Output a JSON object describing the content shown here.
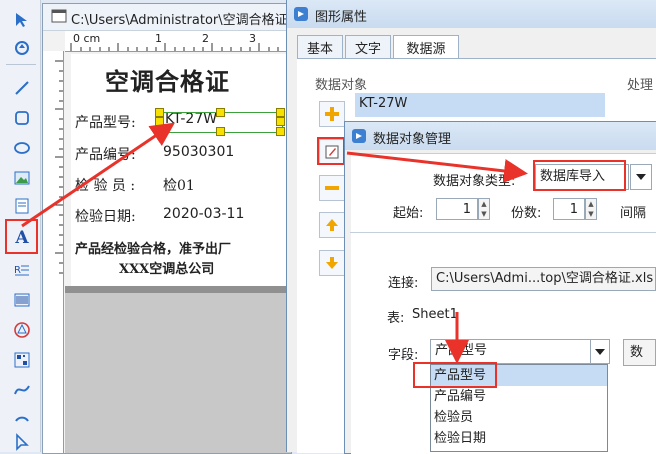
{
  "canvas_window": {
    "title": "C:\\Users\\Administrator\\空调合格证",
    "ruler_labels": [
      "0 cm",
      "1",
      "2",
      "3",
      "4"
    ],
    "label": {
      "heading": "空调合格证",
      "rows": [
        {
          "name": "产品型号:",
          "value": "KT-27W"
        },
        {
          "name": "产品编号:",
          "value": "95030301"
        },
        {
          "name": "检 验 员 :",
          "value": "检01"
        },
        {
          "name": "检验日期:",
          "value": "2020-03-11"
        }
      ],
      "footer_line1": "产品经检验合格，准予出厂",
      "footer_line2": "XXX空调总公司"
    }
  },
  "props_dialog": {
    "title": "图形属性",
    "tabs": [
      "基本",
      "文字",
      "数据源"
    ],
    "active_tab": "数据源",
    "data_object_label": "数据对象",
    "data_object_value": "KT-27W",
    "processing_label": "处理"
  },
  "dom_dialog": {
    "title": "数据对象管理",
    "type_label": "数据对象类型:",
    "type_value": "数据库导入",
    "start_label": "起始:",
    "start_value": "1",
    "copies_label": "份数:",
    "copies_value": "1",
    "interval_label": "间隔",
    "connect_label": "连接:",
    "connect_value": "C:\\Users\\Admi...top\\空调合格证.xls",
    "table_label": "表:",
    "table_value": "Sheet1",
    "field_label": "字段:",
    "field_value": "产品型号",
    "field_options": [
      "产品型号",
      "产品编号",
      "检验员",
      "检验日期"
    ],
    "selected_option": "产品型号",
    "right_button_partial": "数"
  },
  "colors": {
    "annotation_red": "#e8322a",
    "handle_yellow": "#f6e100",
    "selection_blue": "#3c78d8"
  }
}
